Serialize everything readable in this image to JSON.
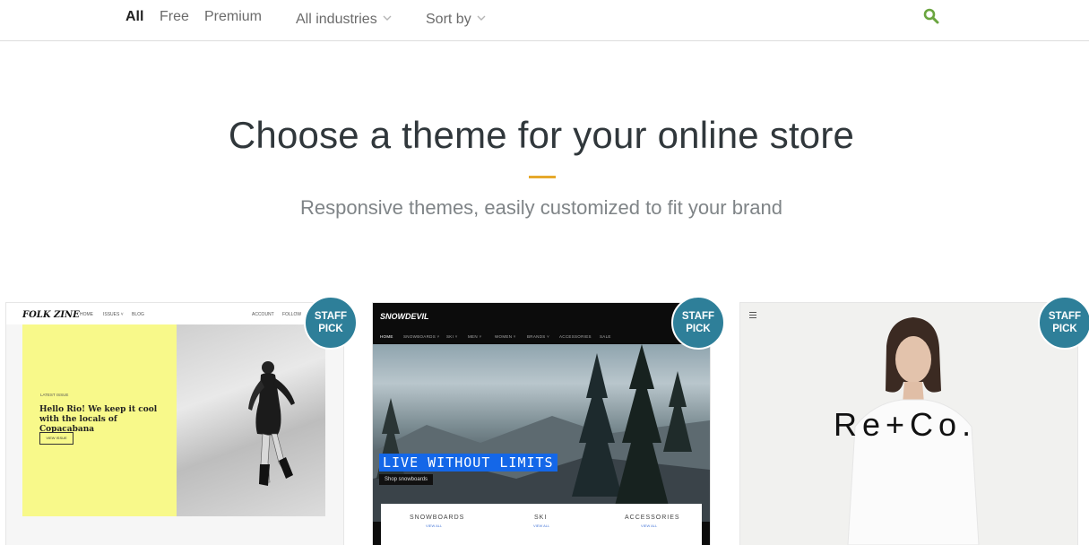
{
  "filters": {
    "tabs": [
      {
        "label": "All",
        "active": true
      },
      {
        "label": "Free",
        "active": false
      },
      {
        "label": "Premium",
        "active": false
      }
    ],
    "industries_label": "All industries",
    "sort_label": "Sort by",
    "search_icon": "search-icon",
    "search_color": "#6aa53f"
  },
  "hero": {
    "title": "Choose a theme for your online store",
    "subtitle": "Responsive themes, easily customized to fit your brand",
    "accent_color": "#e6a92c"
  },
  "badge": {
    "line1": "STAFF",
    "line2": "PICK",
    "color": "#2e7f99"
  },
  "themes": [
    {
      "id": "folk-zine",
      "logo": "FOLK ZINE",
      "nav": [
        "HOME",
        "ISSUES ˅",
        "BLOG"
      ],
      "nav_right": [
        "ACCOUNT",
        "FOLLOW"
      ],
      "latest_label": "LATEST ISSUE",
      "headline": "Hello Rio! We keep it cool with the locals of Copacabana",
      "button": "VIEW ISSUE"
    },
    {
      "id": "snowdevil",
      "logo": "SNOWDEVIL",
      "nav": [
        "HOME",
        "SNOWBOARDS ˅",
        "SKI ˅",
        "MEN ˅",
        "WOMEN ˅",
        "BRANDS ˅",
        "ACCESSORIES",
        "SALE"
      ],
      "headline": "LIVE WITHOUT LIMITS",
      "shop_button": "Shop snowboards",
      "categories": [
        {
          "label": "SNOWBOARDS",
          "link": "VIEW ALL"
        },
        {
          "label": "SKI",
          "link": "VIEW ALL"
        },
        {
          "label": "ACCESSORIES",
          "link": "VIEW ALL"
        }
      ]
    },
    {
      "id": "re-co",
      "logo": "Re+Co."
    }
  ]
}
